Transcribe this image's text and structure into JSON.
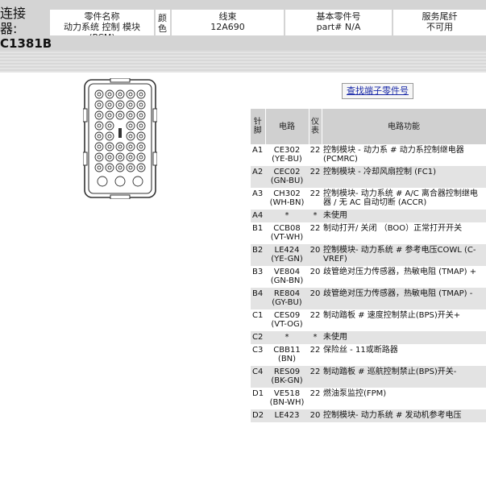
{
  "header": {
    "connector_label_1": "连接",
    "connector_label_2": "器:",
    "connector_id": "C1381B",
    "part_name_caption": "零件名称",
    "part_name_value": "动力系统 控制 模块 (PCM)",
    "color_caption": "颜色",
    "harness_caption": "线束",
    "harness_value": "12A690",
    "base_part_caption": "基本零件号",
    "base_part_value": "part# N/A",
    "service_pigtail_caption": "服务尾纤",
    "service_pigtail_value": "不可用"
  },
  "find_terminal_link": "查找端子零件号",
  "table": {
    "headers": {
      "pin": "针脚",
      "circuit": "电路",
      "gauge": "仪表",
      "function": "电路功能"
    },
    "rows": [
      {
        "pin": "A1",
        "circuit": "CE302 (YE-BU)",
        "gauge": "22",
        "function": "控制模块 - 动力系 # 动力系控制继电器 (PCMRC)"
      },
      {
        "pin": "A2",
        "circuit": "CEC02 (GN-BU)",
        "gauge": "22",
        "function": "控制模块 - 冷却风扇控制 (FC1)"
      },
      {
        "pin": "A3",
        "circuit": "CH302 (WH-BN)",
        "gauge": "22",
        "function": "控制模块- 动力系统 # A/C 离合器控制继电器 / 无 AC 自动切断 (ACCR)"
      },
      {
        "pin": "A4",
        "circuit": "*",
        "gauge": "*",
        "function": "未使用"
      },
      {
        "pin": "B1",
        "circuit": "CCB08 (VT-WH)",
        "gauge": "22",
        "function": "制动打开/ 关闭 （BOO）正常打开开关"
      },
      {
        "pin": "B2",
        "circuit": "LE424 (YE-GN)",
        "gauge": "20",
        "function": "控制模块- 动力系统 # 参考电压COWL (C-VREF)"
      },
      {
        "pin": "B3",
        "circuit": "VE804 (GN-BN)",
        "gauge": "20",
        "function": "歧管绝对压力传感器，热敏电阻 (TMAP) +"
      },
      {
        "pin": "B4",
        "circuit": "RE804 (GY-BU)",
        "gauge": "20",
        "function": "歧管绝对压力传感器，热敏电阻 (TMAP) -"
      },
      {
        "pin": "C1",
        "circuit": "CES09 (VT-OG)",
        "gauge": "22",
        "function": "制动踏板 # 速度控制禁止(BPS)开关+"
      },
      {
        "pin": "C2",
        "circuit": "*",
        "gauge": "*",
        "function": "未使用"
      },
      {
        "pin": "C3",
        "circuit": "CBB11 (BN)",
        "gauge": "22",
        "function": "保险丝 - 11或断路器"
      },
      {
        "pin": "C4",
        "circuit": "RES09 (BK-GN)",
        "gauge": "22",
        "function": "制动踏板 # 巡航控制禁止(BPS)开关-"
      },
      {
        "pin": "D1",
        "circuit": "VE518 (BN-WH)",
        "gauge": "22",
        "function": "燃油泵监控(FPM)"
      },
      {
        "pin": "D2",
        "circuit": "LE423",
        "gauge": "20",
        "function": "控制模块- 动力系统 # 发动机参考电压"
      }
    ]
  },
  "colors": {
    "header_bg": "#d4d4d4",
    "row_alt_bg": "#e3e3e3",
    "table_header_bg": "#d0d0d0",
    "link": "#1a2aa8"
  },
  "icons": {
    "connector": "connector-face-diagram"
  }
}
